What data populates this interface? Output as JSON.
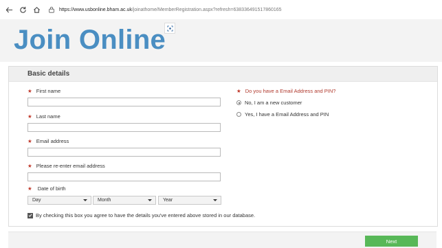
{
  "browser": {
    "url_host": "https://www.usbonline.bham.ac.uk",
    "url_path": "/joinathome/MemberRegistration.aspx?refresh=638336491517860165"
  },
  "header": {
    "title": "Join Online"
  },
  "form": {
    "section_title": "Basic details",
    "required_marker": "★",
    "fields": {
      "first_name": "First name",
      "last_name": "Last name",
      "email": "Email address",
      "email_confirm": "Please re-enter email address",
      "dob": "Date of birth"
    },
    "dob": {
      "day": "Day",
      "month": "Month",
      "year": "Year"
    },
    "pin_question": "Do you have a Email Address and PIN?",
    "pin_options": [
      {
        "label": "No, I am a new customer",
        "selected": true
      },
      {
        "label": "Yes, I have a Email Address and PIN",
        "selected": false
      }
    ],
    "consent_text": "By checking this box you agree to have the details you've entered above stored in our database.",
    "consent_checked": true
  },
  "footer": {
    "next_label": "Next"
  },
  "colors": {
    "brand": "#4a8ec2",
    "required": "#c0392b",
    "next_button": "#58b858"
  }
}
